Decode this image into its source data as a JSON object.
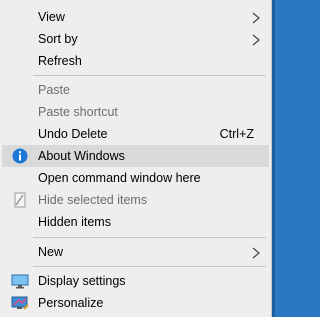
{
  "menu": {
    "items": [
      {
        "label": "View"
      },
      {
        "label": "Sort by"
      },
      {
        "label": "Refresh"
      },
      {
        "label": "Paste"
      },
      {
        "label": "Paste shortcut"
      },
      {
        "label": "Undo Delete",
        "shortcut": "Ctrl+Z"
      },
      {
        "label": "About Windows"
      },
      {
        "label": "Open command window here"
      },
      {
        "label": "Hide selected items"
      },
      {
        "label": "Hidden items"
      },
      {
        "label": "New"
      },
      {
        "label": "Display settings"
      },
      {
        "label": "Personalize"
      }
    ]
  },
  "colors": {
    "menu_bg": "#eeeeee",
    "hover_bg": "#d9d9d9",
    "disabled_text": "#6d6d6d",
    "desktop_bg": "#2a78c2",
    "info_blue": "#1e78d7"
  }
}
